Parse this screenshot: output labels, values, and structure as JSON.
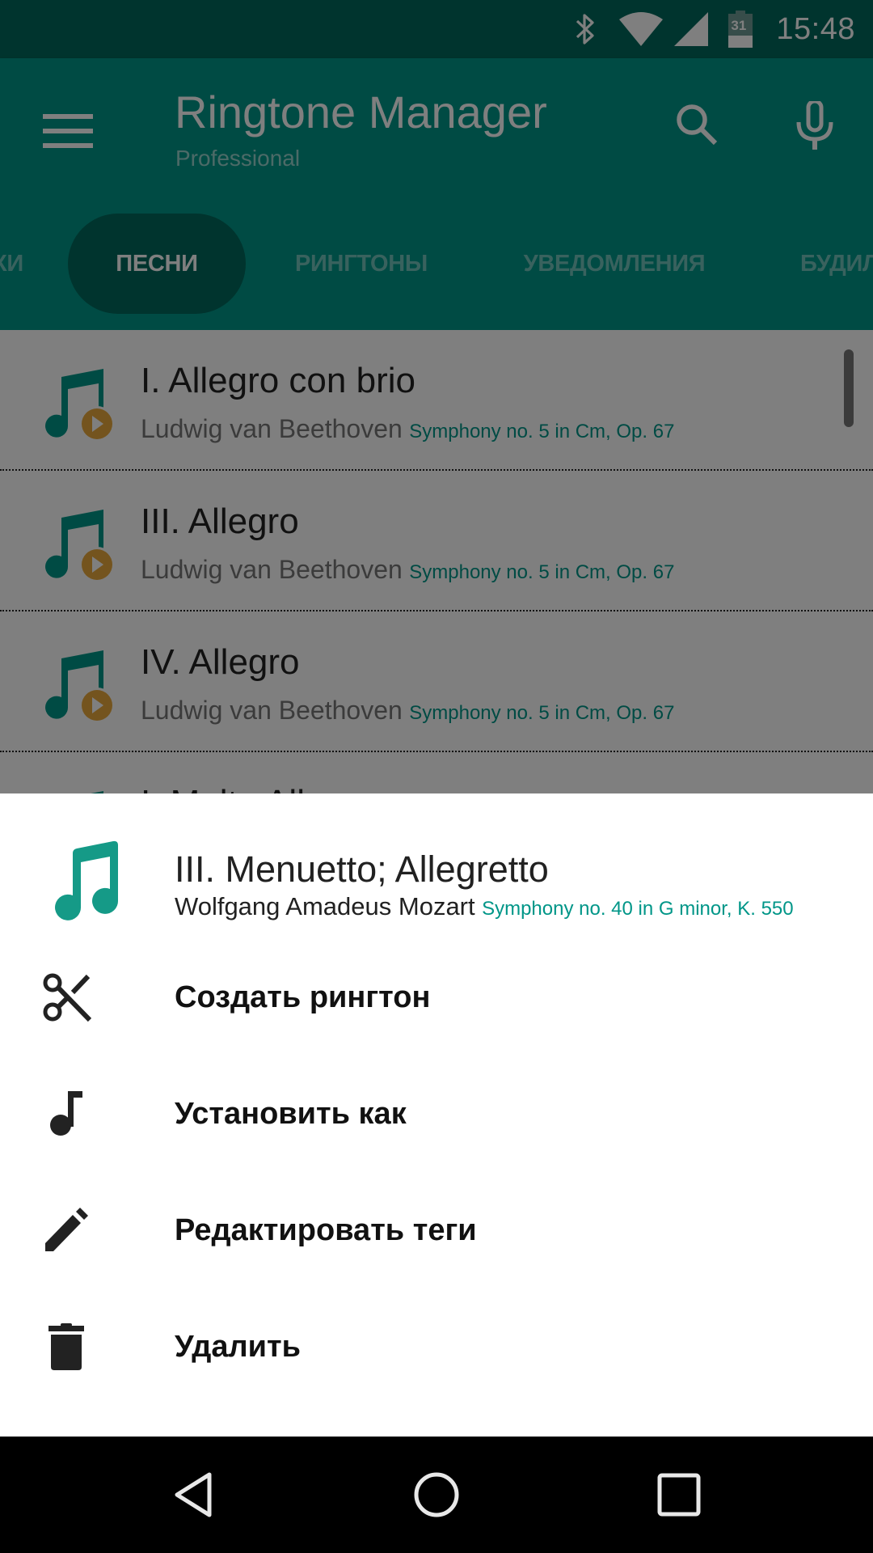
{
  "status_bar": {
    "time": "15:48",
    "battery_level": "31",
    "icons": [
      "bluetooth-icon",
      "wifi-icon",
      "cell-signal-icon",
      "battery-icon"
    ]
  },
  "app_bar": {
    "title": "Ringtone Manager",
    "subtitle": "Professional",
    "icons": {
      "menu": "menu-icon",
      "search": "search-icon",
      "voice": "mic-icon"
    }
  },
  "tabs": [
    {
      "label": "КИ",
      "active": false
    },
    {
      "label": "ПЕСНИ",
      "active": true
    },
    {
      "label": "РИНГТОНЫ",
      "active": false
    },
    {
      "label": "УВЕДОМЛЕНИЯ",
      "active": false
    },
    {
      "label": "БУДИЛ",
      "active": false
    }
  ],
  "songs": [
    {
      "title": "I. Allegro con brio",
      "artist": "Ludwig van Beethoven",
      "album": "Symphony no. 5 in Cm, Op. 67"
    },
    {
      "title": "III. Allegro",
      "artist": "Ludwig van Beethoven",
      "album": "Symphony no. 5 in Cm, Op. 67"
    },
    {
      "title": "IV. Allegro",
      "artist": "Ludwig van Beethoven",
      "album": "Symphony no. 5 in Cm, Op. 67"
    },
    {
      "title": "I. Molto All",
      "artist": "",
      "album": ""
    }
  ],
  "sheet": {
    "title": "III. Menuetto; Allegretto",
    "artist": "Wolfgang Amadeus Mozart",
    "album": "Symphony no. 40 in G minor, K. 550",
    "actions": [
      {
        "label": "Создать рингтон",
        "icon": "scissors-icon"
      },
      {
        "label": "Установить как",
        "icon": "music-note-icon"
      },
      {
        "label": "Редактировать теги",
        "icon": "pencil-icon"
      },
      {
        "label": "Удалить",
        "icon": "trash-icon"
      }
    ]
  },
  "nav_bar": {
    "back": "back-icon",
    "home": "home-icon",
    "recents": "recents-icon"
  },
  "colors": {
    "primary": "#009688",
    "primary_dark": "#00695c",
    "accent": "#f4b400",
    "scrim": "rgba(0,0,0,0.5)"
  }
}
